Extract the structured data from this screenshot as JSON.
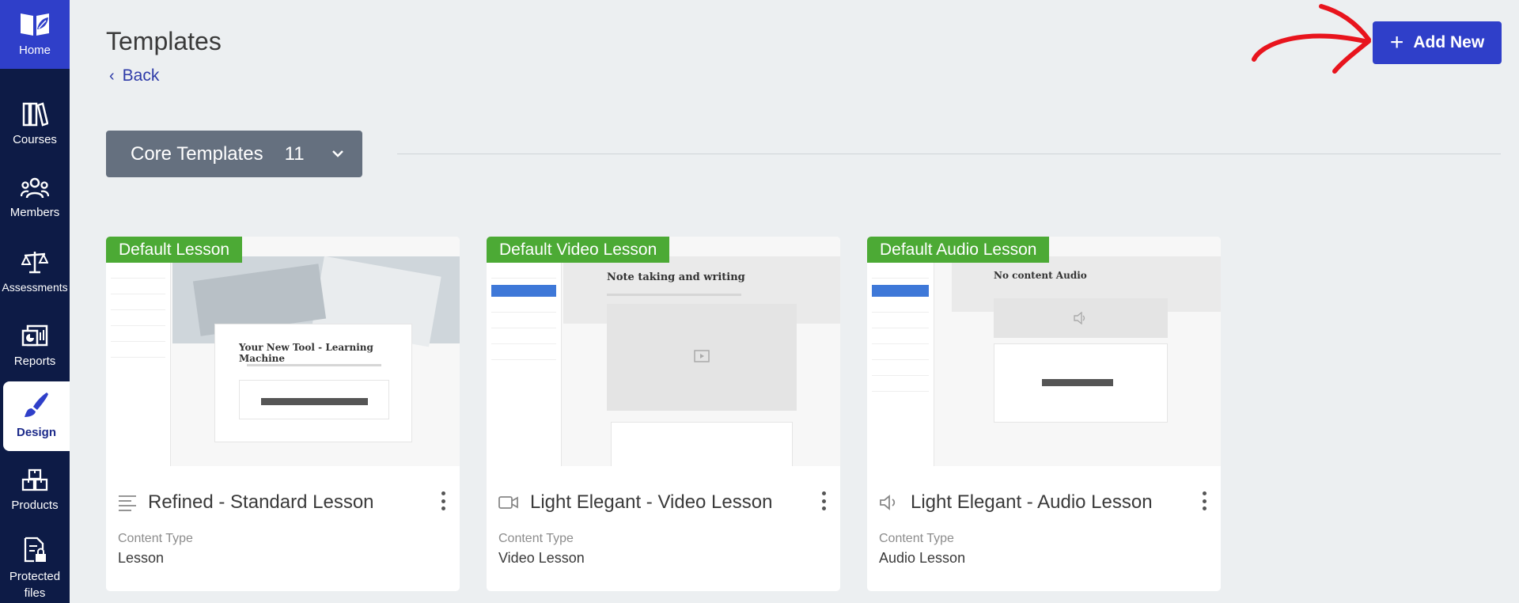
{
  "sidebar": {
    "items": [
      {
        "label": "Home",
        "icon": "book-leaf-icon"
      },
      {
        "label": "Courses",
        "icon": "books-icon"
      },
      {
        "label": "Members",
        "icon": "people-icon"
      },
      {
        "label": "Assessments",
        "icon": "scales-icon"
      },
      {
        "label": "Reports",
        "icon": "report-chart-icon"
      },
      {
        "label": "Design",
        "icon": "paintbrush-icon",
        "active": true
      },
      {
        "label": "Products",
        "icon": "boxes-icon"
      },
      {
        "label": "Protected files",
        "icon": "locked-file-icon"
      }
    ]
  },
  "header": {
    "title": "Templates",
    "back_label": "Back",
    "add_new_label": "Add New"
  },
  "filter": {
    "label": "Core Templates",
    "count": "11"
  },
  "cards": [
    {
      "badge": "Default Lesson",
      "title": "Refined - Standard Lesson",
      "content_type_label": "Content Type",
      "content_type": "Lesson",
      "icon": "text-lines-icon",
      "preview_heading": "Your New Tool - Learning Machine"
    },
    {
      "badge": "Default Video Lesson",
      "title": "Light Elegant - Video Lesson",
      "content_type_label": "Content Type",
      "content_type": "Video Lesson",
      "icon": "video-camera-icon",
      "preview_heading": "Note taking and writing"
    },
    {
      "badge": "Default Audio Lesson",
      "title": "Light Elegant - Audio Lesson",
      "content_type_label": "Content Type",
      "content_type": "Audio Lesson",
      "icon": "speaker-icon",
      "preview_heading": "No content Audio"
    }
  ],
  "colors": {
    "sidebar_bg": "#0d1b46",
    "accent_blue": "#2f3fc9",
    "badge_green": "#4caa35",
    "dropdown_gray": "#65707f",
    "annotation_red": "#e8141d"
  }
}
